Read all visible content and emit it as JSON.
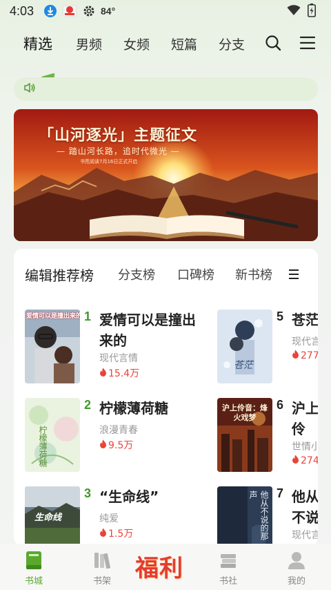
{
  "status_bar": {
    "time": "4:03",
    "temperature": "84°"
  },
  "top_tabs": [
    {
      "label": "精选",
      "active": true
    },
    {
      "label": "男频"
    },
    {
      "label": "女频"
    },
    {
      "label": "短篇"
    },
    {
      "label": "分支"
    }
  ],
  "banner": {
    "title": "「山河逐光」主题征文",
    "subtitle": "— 踏山河长路，追时代微光 —",
    "note": "书荒阅读7月16日正式开启"
  },
  "ranking": {
    "tabs": [
      {
        "label": "编辑推荐榜",
        "active": true
      },
      {
        "label": "分支榜"
      },
      {
        "label": "口碑榜"
      },
      {
        "label": "新书榜"
      }
    ],
    "books": [
      {
        "rank": "1",
        "title": "爱情可以是撞出来的",
        "genre": "现代言情",
        "heat": "15.4万",
        "cover_text": "爱情可以是撞出来的"
      },
      {
        "rank": "2",
        "title": "柠檬薄荷糖",
        "genre": "浪漫青春",
        "heat": "9.5万",
        "cover_text": "柠檬薄荷糖"
      },
      {
        "rank": "3",
        "title": "“生命线”",
        "genre": "纯爱",
        "heat": "1.5万",
        "cover_text": "生命线"
      },
      {
        "rank": "5",
        "title": "苍茫",
        "genre": "现代言",
        "heat": "277",
        "cover_text": "苍茫"
      },
      {
        "rank": "6",
        "title": "沪上伶音：烽火戏梦",
        "genre": "世情小",
        "heat": "274",
        "cover_text": "沪上伶音：烽火戏梦"
      },
      {
        "rank": "7",
        "title": "他从不说的那些声",
        "genre": "现代言",
        "heat": "",
        "cover_text": "他从不说的那一声"
      }
    ],
    "rank_colors": {
      "green": "#3f9a2a"
    }
  },
  "bottom_nav": [
    {
      "label": "书城",
      "active": true
    },
    {
      "label": "书架"
    },
    {
      "label": "福利"
    },
    {
      "label": "书社"
    },
    {
      "label": "我的"
    }
  ],
  "colors": {
    "accent": "#5aa92e",
    "heat": "#e9443a",
    "fuli": "#e63b2e"
  }
}
